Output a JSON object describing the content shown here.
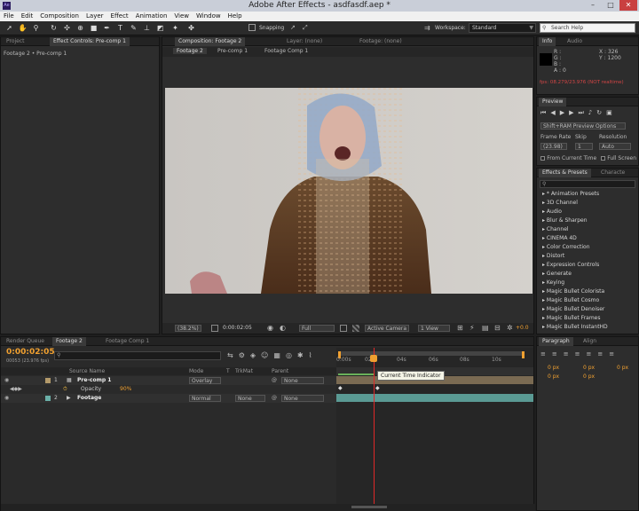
{
  "app": {
    "title": "Adobe After Effects - asdfasdf.aep *",
    "logo": "Ae"
  },
  "menu": [
    "File",
    "Edit",
    "Composition",
    "Layer",
    "Effect",
    "Animation",
    "View",
    "Window",
    "Help"
  ],
  "toolbar": {
    "snapping_label": "Snapping",
    "workspace_label": "Workspace:",
    "workspace_value": "Standard",
    "search_placeholder": "Search Help"
  },
  "left_panel": {
    "tab_project": "Project",
    "tab_effect_controls": "Effect Controls: Pre-comp 1",
    "breadcrumb": "Footage 2 • Pre-comp 1"
  },
  "comp_panel": {
    "tab_composition": "Composition: Footage 2",
    "tab_layer": "Layer: (none)",
    "tab_footage": "Footage: (none)",
    "crumbs": [
      "Footage 2",
      "Pre-comp 1",
      "Footage Comp 1"
    ],
    "zoom": "(38.2%)",
    "timecode": "0:00:02:05",
    "resolution": "Full",
    "camera": "Active Camera",
    "view": "1 View",
    "exposure": "+0.0"
  },
  "info_panel": {
    "tab_info": "Info",
    "tab_audio": "Audio",
    "r": "R :",
    "g": "G :",
    "b": "B :",
    "a": "A : 0",
    "x": "X : 326",
    "y": "Y : 1200",
    "fps": "fps: 08.279/23.976 (NOT realtime)"
  },
  "preview_panel": {
    "tab": "Preview",
    "options": "Shift+RAM Preview Options",
    "frame_rate_label": "Frame Rate",
    "skip_label": "Skip",
    "resolution_label": "Resolution",
    "frame_rate_value": "(23.98)",
    "skip_value": "1",
    "resolution_value": "Auto",
    "from_current": "From Current Time",
    "full_screen": "Full Screen"
  },
  "effects_panel": {
    "tab": "Effects & Presets",
    "tab2": "Characte",
    "search_placeholder": "",
    "items": [
      "* Animation Presets",
      "3D Channel",
      "Audio",
      "Blur & Sharpen",
      "Channel",
      "CINEMA 4D",
      "Color Correction",
      "Distort",
      "Expression Controls",
      "Generate",
      "Keying",
      "Magic Bullet Colorista",
      "Magic Bullet Cosmo",
      "Magic Bullet Denoiser",
      "Magic Bullet Frames",
      "Magic Bullet InstantHD"
    ]
  },
  "paragraph_panel": {
    "tab": "Paragraph",
    "tab2": "Align",
    "values": [
      "0 px",
      "0 px",
      "0 px",
      "0 px",
      "0 px"
    ]
  },
  "timeline": {
    "tab_render": "Render Queue",
    "tab_footage2": "Footage 2",
    "tab_footage_comp": "Footage Comp 1",
    "timecode": "0:00:02:05",
    "frames": "00053 (23.976 fps)",
    "col_source": "Source Name",
    "col_mode": "Mode",
    "col_t": "T",
    "col_trkmat": "TrkMat",
    "col_parent": "Parent",
    "ruler": [
      "0:00s",
      "02s",
      "04s",
      "06s",
      "08s",
      "10s"
    ],
    "tooltip": "Current Time Indicator",
    "layers": [
      {
        "num": "1",
        "name": "Pre-comp 1",
        "mode": "Overlay",
        "trkmat": "",
        "parent": "None"
      },
      {
        "num": "2",
        "name": "Footage",
        "mode": "Normal",
        "trkmat": "None",
        "parent": "None"
      }
    ],
    "opacity_label": "Opacity",
    "opacity_value": "90%"
  },
  "colors": {
    "accent": "#f0a030",
    "time_indicator": "#e02828",
    "bar_precomp": "#7a6a52",
    "bar_footage": "#5a9a94"
  }
}
